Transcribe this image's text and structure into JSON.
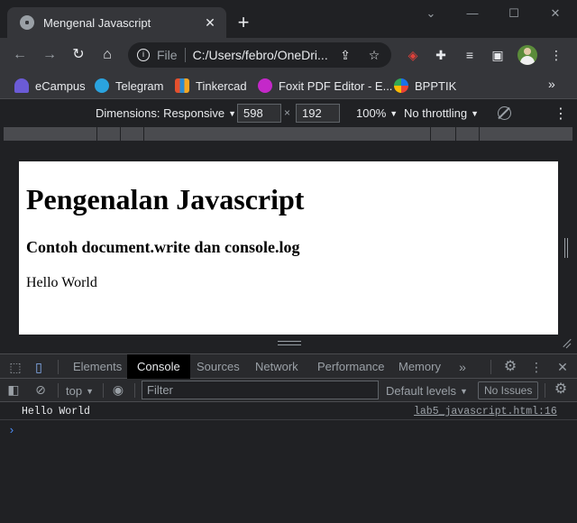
{
  "browser": {
    "tab_title": "Mengenal Javascript",
    "tab_close": "✕",
    "new_tab": "+",
    "window_controls": {
      "minimize": "—",
      "maximize": "☐",
      "close": "✕",
      "dropdown": "⌄"
    },
    "address": {
      "scheme": "File",
      "url": "C:/Users/febro/OneDri..."
    },
    "bookmarks": [
      {
        "label": "eCampus",
        "icon": "ecampus-icon",
        "color": "#6b5bd6"
      },
      {
        "label": "Telegram",
        "icon": "telegram-icon",
        "color": "#2aa3df"
      },
      {
        "label": "Tinkercad",
        "icon": "tinkercad-icon",
        "color": "#e5502d"
      },
      {
        "label": "Foxit PDF Editor - E...",
        "icon": "foxit-icon",
        "color": "#c428c9"
      },
      {
        "label": "BPPTIK",
        "icon": "bpptik-icon",
        "color": "#1a73e8"
      }
    ],
    "bookmarks_more": "»"
  },
  "device_toolbar": {
    "dimensions_label": "Dimensions: Responsive",
    "width": "598",
    "height": "192",
    "zoom": "100%",
    "throttling": "No throttling"
  },
  "page": {
    "heading": "Pengenalan Javascript",
    "subheading": "Contoh document.write dan console.log",
    "body_text": "Hello World"
  },
  "devtools": {
    "tabs": [
      "Elements",
      "Console",
      "Sources",
      "Network",
      "Performance",
      "Memory"
    ],
    "active_tab": "Console",
    "more_tabs": "»",
    "context": "top",
    "filter_placeholder": "Filter",
    "levels": "Default levels",
    "issues": "No Issues",
    "console_logs": [
      {
        "message": "Hello World",
        "source": "lab5_javascript.html:16"
      }
    ],
    "prompt": "›"
  }
}
